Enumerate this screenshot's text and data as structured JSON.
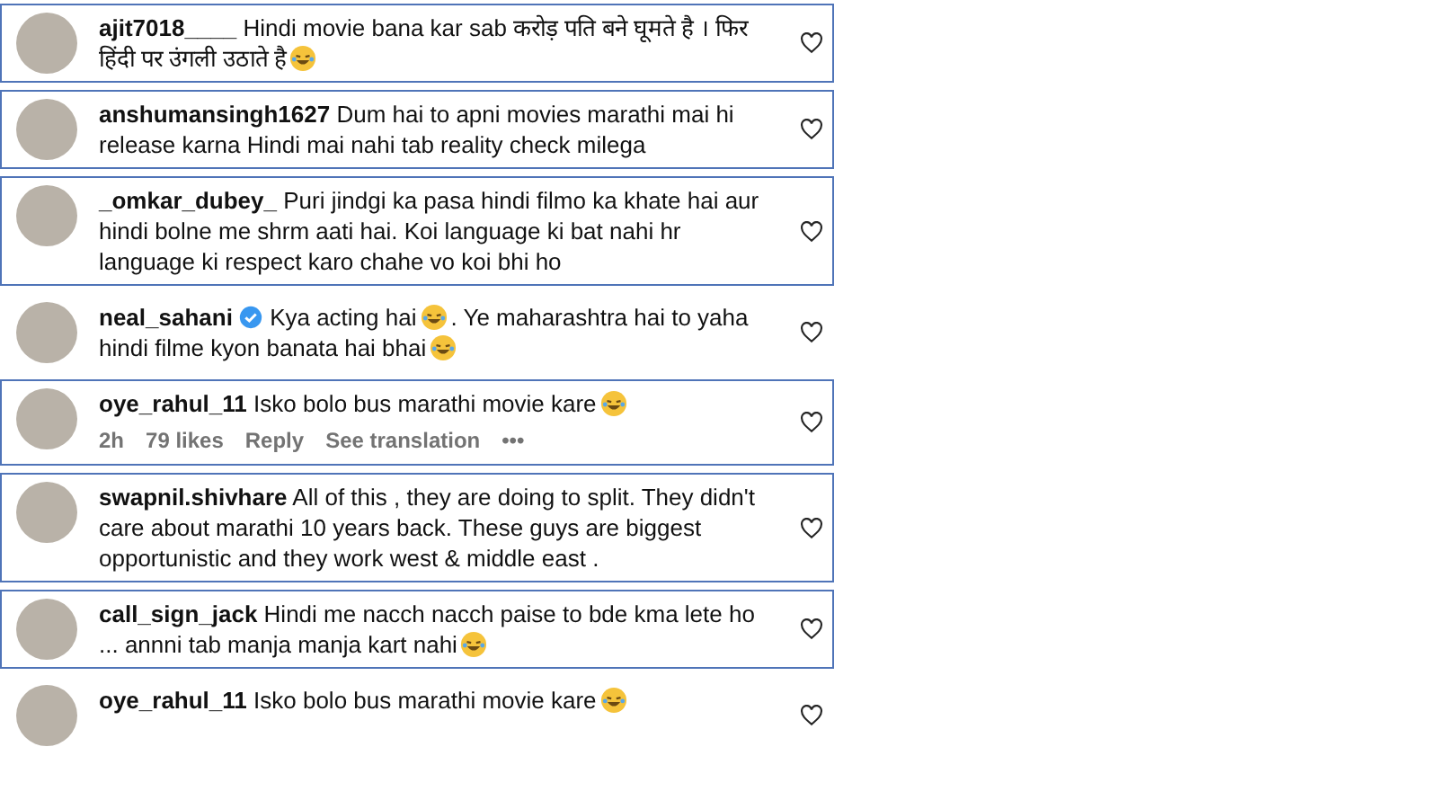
{
  "comments": [
    {
      "username": "ajit7018____",
      "verified": false,
      "framed": true,
      "parts": [
        {
          "kind": "text",
          "text": "Hindi movie bana kar sab करोड़ पति बने घूमते है ।"
        },
        {
          "kind": "text",
          "text": "फिर हिंदी पर उंगली उठाते है"
        },
        {
          "kind": "emoji"
        }
      ],
      "liked": false
    },
    {
      "username": "anshumansingh1627",
      "verified": false,
      "framed": true,
      "parts": [
        {
          "kind": "text",
          "text": "Dum hai to apni movies marathi mai hi release karna Hindi mai nahi tab reality check milega"
        }
      ],
      "liked": false
    },
    {
      "username": "_omkar_dubey_",
      "verified": false,
      "framed": true,
      "parts": [
        {
          "kind": "text",
          "text": "Puri jindgi ka pasa hindi filmo ka khate hai aur hindi bolne me shrm aati hai. Koi language ki bat nahi hr language ki respect karo chahe vo koi bhi ho"
        }
      ],
      "liked": false
    },
    {
      "username": "neal_sahani",
      "verified": true,
      "framed": false,
      "parts": [
        {
          "kind": "text",
          "text": "Kya acting hai"
        },
        {
          "kind": "emoji"
        },
        {
          "kind": "text",
          "text": ". Ye maharashtra hai to yaha hindi filme kyon banata hai bhai"
        },
        {
          "kind": "emoji"
        }
      ],
      "liked": false
    },
    {
      "username": "oye_rahul_11",
      "verified": false,
      "framed": true,
      "parts": [
        {
          "kind": "text",
          "text": "Isko bolo bus marathi movie kare"
        },
        {
          "kind": "emoji"
        }
      ],
      "meta": {
        "time": "2h",
        "likes": "79 likes",
        "reply": "Reply",
        "translate": "See translation",
        "more": "•••"
      },
      "liked": false
    },
    {
      "username": "swapnil.shivhare",
      "verified": false,
      "framed": true,
      "parts": [
        {
          "kind": "text",
          "text": "All of this , they are doing to split. They didn't care about marathi 10 years back. These guys are biggest opportunistic and they work west & middle east ."
        }
      ],
      "liked": false
    },
    {
      "username": "call_sign_jack",
      "verified": false,
      "framed": true,
      "parts": [
        {
          "kind": "text",
          "text": "Hindi me nacch nacch paise to bde kma lete ho ... annni tab manja manja kart nahi"
        },
        {
          "kind": "emoji"
        }
      ],
      "liked": false
    },
    {
      "username": "oye_rahul_11",
      "verified": false,
      "framed": false,
      "parts": [
        {
          "kind": "text",
          "text": "Isko bolo bus marathi movie kare"
        },
        {
          "kind": "emoji"
        }
      ],
      "liked": false
    }
  ]
}
